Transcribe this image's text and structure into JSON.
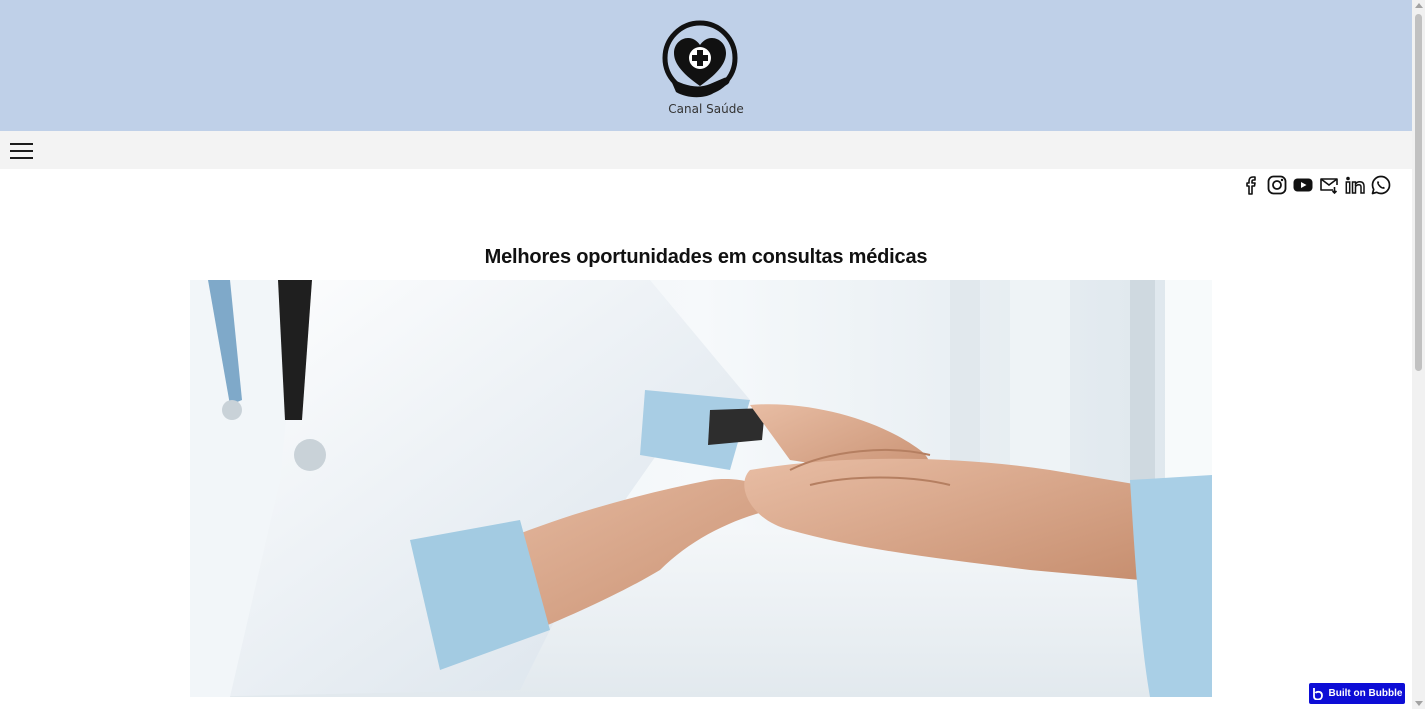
{
  "header": {
    "brand_name": "Canal Saúde",
    "logo_icon": "heart-cross-hand-icon",
    "background": "#bfd0e8"
  },
  "nav": {
    "menu_icon": "hamburger-menu-icon"
  },
  "social": [
    "facebook-icon",
    "instagram-icon",
    "youtube-icon",
    "email-icon",
    "linkedin-icon",
    "whatsapp-icon"
  ],
  "main": {
    "title": "Melhores oportunidades em consultas médicas",
    "hero_image": "doctor-holding-patient-hands-photo"
  },
  "badge": {
    "label": "Built on Bubble",
    "color": "#0d0dd6"
  }
}
